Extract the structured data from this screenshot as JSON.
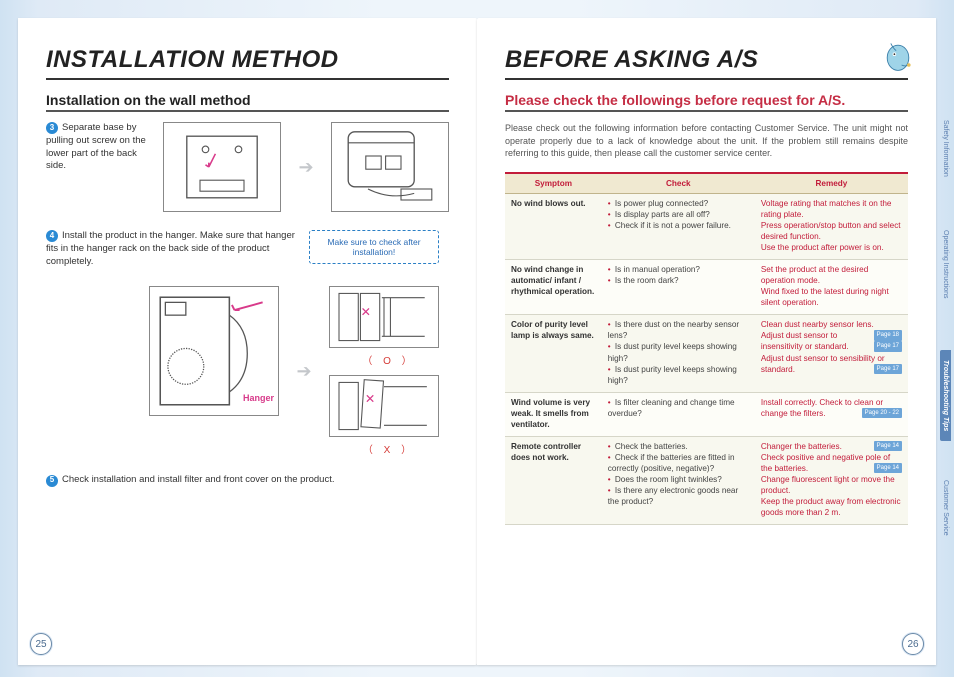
{
  "left": {
    "title": "INSTALLATION METHOD",
    "subtitle": "Installation on the wall method",
    "step3_num": "3",
    "step3": "Separate base by pulling out screw on the lower part of the back side.",
    "step4_num": "4",
    "step4": "Install the product in the hanger. Make sure that hanger fits in the hanger rack on the back side of the product completely.",
    "note": "Make sure to check after installation!",
    "hanger_label": "Hanger",
    "ox_o": "（ O ）",
    "ox_x": "（ X ）",
    "step5_num": "5",
    "step5": "Check installation and install filter and front cover on the product.",
    "page_num": "25"
  },
  "right": {
    "title": "BEFORE ASKING A/S",
    "subtitle": "Please check the followings before request for A/S.",
    "intro": "Please check out the following information before contacting Customer Service. The unit might not operate properly due to a lack of knowledge about the unit. If the problem still remains despite referring to this guide, then please call the customer service center.",
    "headers": {
      "symptom": "Symptom",
      "check": "Check",
      "remedy": "Remedy"
    },
    "rows": [
      {
        "symptom": "No wind blows out.",
        "checks": [
          "Is power plug connected?",
          "Is display parts are all off?",
          "Check if it is not a power failure."
        ],
        "remedies": [
          "Voltage rating that matches it on the rating plate.",
          "Press operation/stop button and select desired function.",
          "Use the product after power is on."
        ],
        "refs": [
          "",
          "",
          ""
        ]
      },
      {
        "symptom": "No wind change in automatic/ infant / rhythmical operation.",
        "checks": [
          "Is in manual operation?",
          "Is the room dark?"
        ],
        "remedies": [
          "Set the product at the desired operation mode.",
          "Wind fixed to the latest during night silent operation."
        ],
        "refs": [
          "",
          ""
        ]
      },
      {
        "symptom": "Color of purity level lamp is always same.",
        "checks": [
          "Is there dust on the nearby sensor lens?",
          "Is dust purity level keeps showing high?",
          "Is dust purity level keeps showing high?"
        ],
        "remedies": [
          "Clean dust nearby sensor lens.",
          "Adjust dust sensor to insensitivity or standard.",
          "Adjust dust sensor to sensibility or standard."
        ],
        "refs": [
          "Page 18",
          "Page 17",
          "Page 17"
        ]
      },
      {
        "symptom": "Wind volume is very weak. It smells from ventilator.",
        "checks": [
          "Is filter cleaning and change time overdue?"
        ],
        "remedies": [
          "Install correctly. Check to clean or change the filters."
        ],
        "refs": [
          "Page 20 - 22"
        ]
      },
      {
        "symptom": "Remote controller does not work.",
        "checks": [
          "Check the batteries.",
          "Check if the batteries are fitted in correctly (positive, negative)?",
          "Does the room light twinkles?",
          "Is there any electronic goods near the product?"
        ],
        "remedies": [
          "Changer the batteries.",
          "Check positive and negative pole of the batteries.",
          "Change fluorescent light or move the product.",
          "Keep the product away from electronic goods more than 2 m."
        ],
        "refs": [
          "Page 14",
          "Page 14",
          "",
          ""
        ]
      }
    ],
    "page_num": "26"
  },
  "tabs": {
    "t1": "Safety Information",
    "t2": "Operating Instructions",
    "t3": "Troubleshooting Tips",
    "t4": "Customer Service"
  }
}
